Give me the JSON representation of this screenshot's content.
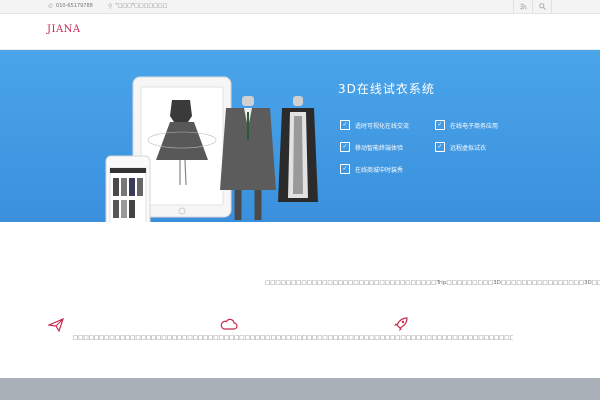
{
  "topbar": {
    "phone_icon": "phone-icon",
    "phone": "010-65179788",
    "location_icon": "map-pin-icon",
    "location": "\"□□□\"□□□□□□□",
    "tools": [
      "rss-icon",
      "search-icon"
    ]
  },
  "header": {
    "logo": "JIANA"
  },
  "banner": {
    "title": "3D在线试衣系统",
    "features": [
      "适时可视化在线交流",
      "在线电子商务应用",
      "移动智能终端体验",
      "远程虚拟试衣",
      "在线商城中时装秀"
    ],
    "colors": {
      "bg_top": "#4aa5ea",
      "bg_bottom": "#3b90dd"
    }
  },
  "content": {
    "intro": "□□□□□□□□□□□□□□□□□□□□□□□□□□□□□□□□□Trip□□□□□□□□□3D□□□□□□□□□□□□□□□□3D□□□□□□□□□3D□□□□□□□□□□□□□□□□□□□□",
    "icons": [
      "paper-plane-icon",
      "cloud-icon",
      "rocket-icon"
    ],
    "desc": "□□□□□□□□□□□□□□□□□□□□□□□□□□□□□□□□□□□□□□□□□□□□□□□□□□□□□□□□□□□□□□□□□□□□□□□□□□□□□□□□□□□□□□□□□□□□□□□□□□□□□□3D□□□□□(3D)□□□□□□□□□□□□□□□□□□□□",
    "accent": "#c8294f"
  }
}
